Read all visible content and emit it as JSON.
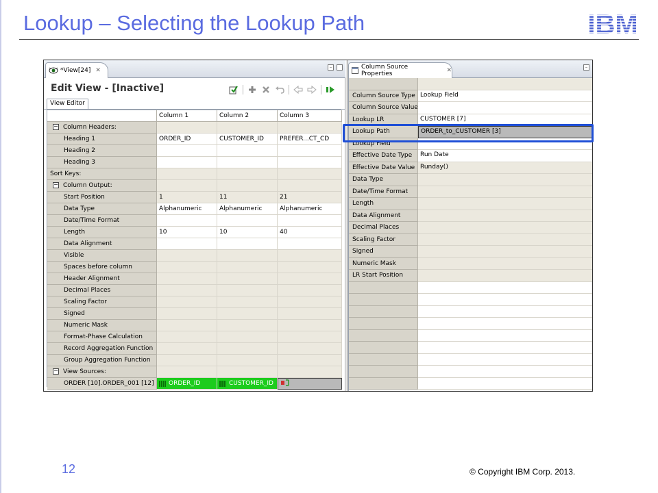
{
  "slide": {
    "title": "Lookup – Selecting the Lookup Path",
    "logo_text": "IBM",
    "page_number": "12",
    "copyright": "© Copyright  IBM Corp. 2013.",
    "accent_color": "#5a6be0",
    "highlight_color": "#1f4fd6"
  },
  "left_pane": {
    "tab_label": "*View[24]",
    "tab_close": "✕",
    "editor_title": "Edit View - [Inactive]",
    "subtab_label": "View Editor",
    "toolbar_icons": [
      "activate-view-icon",
      "add-column-icon",
      "delete-column-icon",
      "undo-icon",
      "move-left-icon",
      "move-right-icon",
      "run-icon"
    ],
    "columns": [
      "Column 1",
      "Column 2",
      "Column 3"
    ],
    "rows": [
      {
        "label": "Column Headers:",
        "kind": "section",
        "cells": [
          "",
          "",
          ""
        ]
      },
      {
        "label": "Heading 1",
        "cells": [
          "ORDER_ID",
          "CUSTOMER_ID",
          "PREFER...CT_CD"
        ],
        "shade": "white"
      },
      {
        "label": "Heading 2",
        "cells": [
          "",
          "",
          ""
        ],
        "shade": "white"
      },
      {
        "label": "Heading 3",
        "cells": [
          "",
          "",
          ""
        ],
        "shade": "white"
      },
      {
        "label": "Sort Keys:",
        "kind": "plain-section",
        "cells": [
          "",
          "",
          ""
        ],
        "shade": "tan"
      },
      {
        "label": "Column Output:",
        "kind": "section",
        "cells": [
          "",
          "",
          ""
        ],
        "shade": "tan"
      },
      {
        "label": "Start Position",
        "cells": [
          "1",
          "11",
          "21"
        ],
        "shade": "tan"
      },
      {
        "label": "Data Type",
        "cells": [
          "Alphanumeric",
          "Alphanumeric",
          "Alphanumeric"
        ],
        "shade": "white"
      },
      {
        "label": "Date/Time Format",
        "cells": [
          "",
          "",
          ""
        ],
        "shade": "white"
      },
      {
        "label": "Length",
        "cells": [
          "10",
          "10",
          "40"
        ],
        "shade": "white"
      },
      {
        "label": "Data Alignment",
        "cells": [
          "",
          "",
          ""
        ],
        "shade": "white"
      },
      {
        "label": "Visible",
        "cells": [
          "",
          "",
          ""
        ],
        "shade": "tan"
      },
      {
        "label": "Spaces before column",
        "cells": [
          "",
          "",
          ""
        ],
        "shade": "tan"
      },
      {
        "label": "Header Alignment",
        "cells": [
          "",
          "",
          ""
        ],
        "shade": "tan"
      },
      {
        "label": "Decimal Places",
        "cells": [
          "",
          "",
          ""
        ],
        "shade": "tan"
      },
      {
        "label": "Scaling Factor",
        "cells": [
          "",
          "",
          ""
        ],
        "shade": "tan"
      },
      {
        "label": "Signed",
        "cells": [
          "",
          "",
          ""
        ],
        "shade": "tan"
      },
      {
        "label": "Numeric Mask",
        "cells": [
          "",
          "",
          ""
        ],
        "shade": "tan"
      },
      {
        "label": "Format-Phase Calculation",
        "cells": [
          "",
          "",
          ""
        ],
        "shade": "tan"
      },
      {
        "label": "Record Aggregation Function",
        "cells": [
          "",
          "",
          ""
        ],
        "shade": "tan"
      },
      {
        "label": "Group Aggregation Function",
        "cells": [
          "",
          "",
          ""
        ],
        "shade": "tan"
      },
      {
        "label": "View Sources:",
        "kind": "section",
        "cells": [
          "",
          "",
          ""
        ],
        "shade": "tan"
      }
    ],
    "view_source_row": {
      "label": "ORDER [10].ORDER_001 [12]",
      "cells": [
        "ORDER_ID",
        "CUSTOMER_ID",
        ""
      ]
    },
    "colors": {
      "green": "#1dcc1d",
      "tan": "#ece9df",
      "label_bg": "#d8d5cb"
    }
  },
  "right_pane": {
    "tab_label": "Column Source Properties",
    "tab_close": "✕",
    "properties": [
      {
        "label": "Column Source Type",
        "value": "Lookup Field",
        "shade": "white"
      },
      {
        "label": "Column Source Value",
        "value": "",
        "shade": "white"
      },
      {
        "label": "Lookup LR",
        "value": "CUSTOMER [7]",
        "shade": "white"
      },
      {
        "label": "Lookup Path",
        "value": "ORDER_to_CUSTOMER [3]",
        "shade": "selected"
      },
      {
        "label": "Lookup Field",
        "value": "",
        "shade": "white"
      },
      {
        "label": "Effective Date Type",
        "value": "Run Date",
        "shade": "white"
      },
      {
        "label": "Effective Date Value",
        "value": "Runday()",
        "shade": "tan"
      },
      {
        "label": "Data Type",
        "value": "",
        "shade": "tan"
      },
      {
        "label": "Date/Time Format",
        "value": "",
        "shade": "tan"
      },
      {
        "label": "Length",
        "value": "",
        "shade": "tan"
      },
      {
        "label": "Data Alignment",
        "value": "",
        "shade": "tan"
      },
      {
        "label": "Decimal Places",
        "value": "",
        "shade": "tan"
      },
      {
        "label": "Scaling Factor",
        "value": "",
        "shade": "tan"
      },
      {
        "label": "Signed",
        "value": "",
        "shade": "tan"
      },
      {
        "label": "Numeric Mask",
        "value": "",
        "shade": "tan"
      },
      {
        "label": "LR Start Position",
        "value": "",
        "shade": "tan"
      }
    ]
  }
}
